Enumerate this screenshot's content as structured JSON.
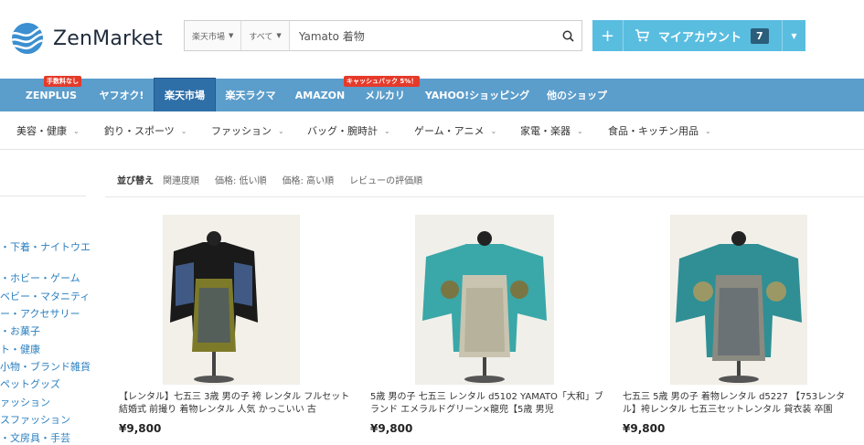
{
  "brand": {
    "logo_text": "ZenMarket"
  },
  "search": {
    "store_select": "楽天市場",
    "category_select": "すべて",
    "query": "Yamato 着物"
  },
  "account": {
    "plus": "+",
    "label": "マイアカウント",
    "cart_count": "7"
  },
  "service_nav": {
    "items": [
      {
        "label": "ZENPLUS",
        "badge": "手数料なし"
      },
      {
        "label": "ヤフオク!",
        "badge": ""
      },
      {
        "label": "楽天市場",
        "badge": ""
      },
      {
        "label": "楽天ラクマ",
        "badge": ""
      },
      {
        "label": "AMAZON",
        "badge": ""
      },
      {
        "label": "メルカリ",
        "badge": "キャッシュバック 5%！"
      },
      {
        "label": "YAHOO!ショッピング",
        "badge": ""
      },
      {
        "label": "他のショップ",
        "badge": ""
      }
    ],
    "active_index": 2
  },
  "category_nav": {
    "items": [
      "美容・健康",
      "釣り・スポーツ",
      "ファッション",
      "バッグ・腕時計",
      "ゲーム・アニメ",
      "家電・楽器",
      "食品・キッチン用品"
    ]
  },
  "sort": {
    "label": "並び替え",
    "options": [
      "関連度順",
      "価格: 低い順",
      "価格: 高い順",
      "レビューの評価順"
    ]
  },
  "left_categories": [
    "・下着・ナイトウエ",
    "・ホビー・ゲーム",
    "ベビー・マタニティ",
    "ー・アクセサリー",
    "・お菓子",
    "ト・健康",
    "小物・ブランド雑貨",
    "ペットグッズ",
    "ァッション",
    "スファッション",
    "・文房具・手芸"
  ],
  "products": [
    {
      "title": "【レンタル】七五三 3歳 男の子 袴 レンタル フルセット 結婚式 前撮り 着物レンタル 人気 かっこいい 古",
      "price": "¥9,800"
    },
    {
      "title": "5歳 男の子 七五三 レンタル d5102 YAMATO「大和」ブランド エメラルドグリーン×龍兜【5歳 男児",
      "price": "¥9,800"
    },
    {
      "title": "七五三 5歳 男の子 着物レンタル d5227 【753レンタル】袴レンタル 七五三セットレンタル 貸衣装 卒園",
      "price": "¥9,800"
    }
  ],
  "colors": {
    "service_nav_bg": "#5b9dcb",
    "service_nav_active": "#2f6fa8",
    "account_button": "#59bde0",
    "badge_red": "#e53a2a",
    "left_link": "#2a7fc0"
  }
}
